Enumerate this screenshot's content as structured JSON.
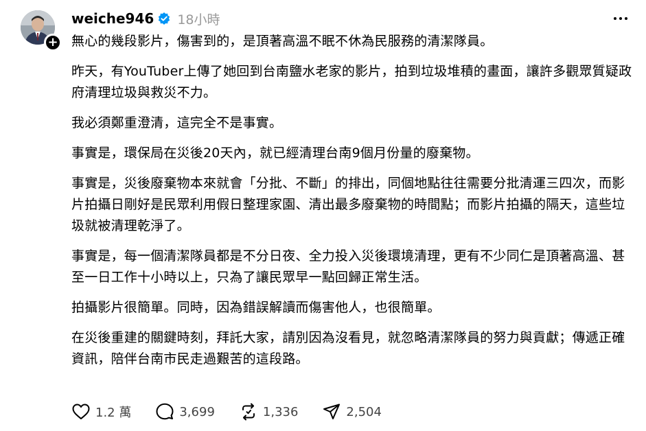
{
  "post": {
    "username": "weiche946",
    "timestamp": "18小時",
    "paragraphs": [
      "無心的幾段影片，傷害到的，是頂著高溫不眠不休為民服務的清潔隊員。",
      "昨天，有YouTuber上傳了她回到台南鹽水老家的影片，拍到垃圾堆積的畫面，讓許多觀眾質疑政府清理垃圾與救災不力。",
      "我必須鄭重澄清，這完全不是事實。",
      "事實是，環保局在災後20天內，就已經清理台南9個月份量的廢棄物。",
      "事實是，災後廢棄物本來就會「分批、不斷」的排出，同個地點往往需要分批清運三四次，而影片拍攝日剛好是民眾利用假日整理家園、清出最多廢棄物的時間點；而影片拍攝的隔天，這些垃圾就被清理乾淨了。",
      "事實是，每一個清潔隊員都是不分日夜、全力投入災後環境清理，更有不少同仁是頂著高溫、甚至一日工作十小時以上，只為了讓民眾早一點回歸正常生活。",
      "拍攝影片很簡單。同時，因為錯誤解讀而傷害他人，也很簡單。",
      "在災後重建的關鍵時刻，拜託大家，請別因為沒看見，就忽略清潔隊員的努力與貢獻；傳遞正確資訊，陪伴台南市民走過艱苦的這段路。"
    ],
    "actions": {
      "likes": "1.2 萬",
      "comments": "3,699",
      "reposts": "1,336",
      "shares": "2,504"
    }
  },
  "icons": {
    "verified": "verified-badge-icon",
    "follow": "plus-icon",
    "more": "more-horizontal-icon",
    "like": "heart-icon",
    "comment": "comment-icon",
    "repost": "repost-icon",
    "share": "send-icon"
  },
  "colors": {
    "verified": "#0095f6",
    "timestamp": "#999999",
    "text": "#000000",
    "counts": "#444444"
  }
}
